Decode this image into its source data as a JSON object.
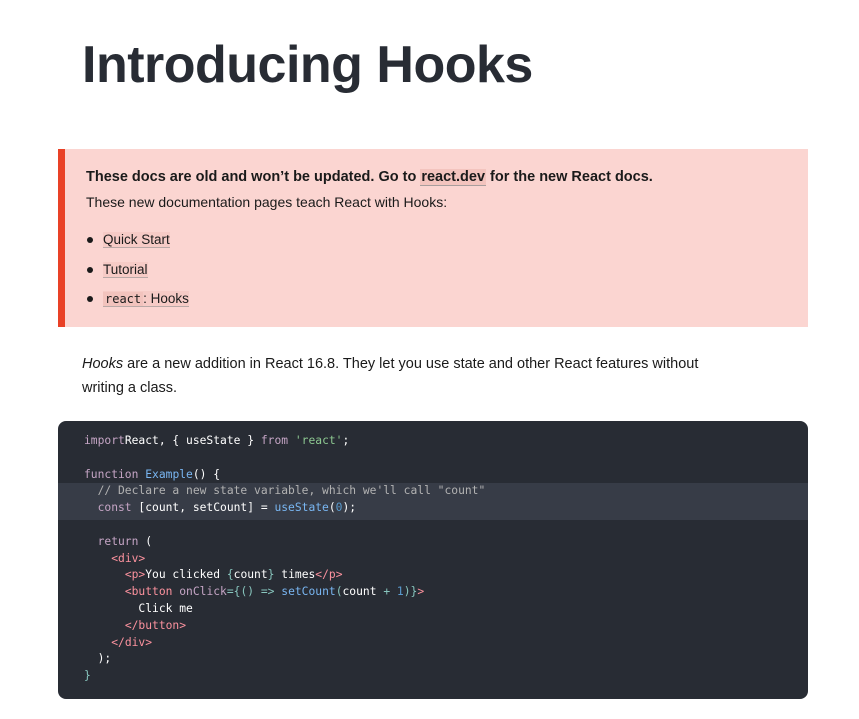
{
  "page": {
    "title": "Introducing Hooks"
  },
  "notice": {
    "heading_before": "These docs are old and won’t be updated. Go to ",
    "heading_link": "react.dev",
    "heading_after": " for the new React docs.",
    "text": "These new documentation pages teach React with Hooks:",
    "items": [
      {
        "label": "Quick Start"
      },
      {
        "label": "Tutorial"
      },
      {
        "code": "react",
        "label": ": Hooks"
      }
    ],
    "colors": {
      "background": "#fbd5d1",
      "border": "#e94126"
    }
  },
  "intro": {
    "em": "Hooks",
    "text": " are a new addition in React 16.8. They let you use state and other React features without writing a class."
  },
  "code": {
    "lines": [
      [
        [
          "k",
          "import"
        ],
        [
          "",
          "React, { useState } "
        ],
        [
          "k",
          "from"
        ],
        [
          "",
          ""
        ],
        [
          "s",
          " 'react'"
        ],
        [
          "",
          ";"
        ]
      ],
      [],
      [
        [
          "k",
          "function"
        ],
        [
          "",
          " "
        ],
        [
          "f",
          "Example"
        ],
        [
          "",
          "() {"
        ]
      ],
      [
        [
          "c",
          "  // Declare a new state variable, which we'll call \"count\""
        ]
      ],
      [
        [
          "k",
          "  const"
        ],
        [
          "",
          " [count, setCount] = "
        ],
        [
          "f",
          "useState"
        ],
        [
          "",
          "("
        ],
        [
          "n",
          "0"
        ],
        [
          "",
          ");"
        ]
      ],
      [],
      [
        [
          "k",
          "  return"
        ],
        [
          "",
          " ("
        ]
      ],
      [
        [
          "",
          "    "
        ],
        [
          "t",
          "<div>"
        ]
      ],
      [
        [
          "",
          "      "
        ],
        [
          "t",
          "<p>"
        ],
        [
          "",
          "You clicked "
        ],
        [
          "p",
          "{"
        ],
        [
          "",
          "count"
        ],
        [
          "p",
          "}"
        ],
        [
          "",
          " times"
        ],
        [
          "t",
          "</p>"
        ]
      ],
      [
        [
          "",
          "      "
        ],
        [
          "t",
          "<button"
        ],
        [
          "",
          " "
        ],
        [
          "a",
          "onClick"
        ],
        [
          "p",
          "={() => "
        ],
        [
          "f",
          "setCount"
        ],
        [
          "p",
          "("
        ],
        [
          "",
          "count"
        ],
        [
          "p",
          " + "
        ],
        [
          "n",
          "1"
        ],
        [
          "p",
          ")}"
        ],
        [
          "t",
          ">"
        ]
      ],
      [
        [
          "",
          "        Click me"
        ]
      ],
      [
        [
          "",
          "      "
        ],
        [
          "t",
          "</button>"
        ]
      ],
      [
        [
          "",
          "    "
        ],
        [
          "t",
          "</div>"
        ]
      ],
      [
        [
          "",
          "  );"
        ]
      ],
      [
        [
          "p",
          "}"
        ]
      ]
    ],
    "colors": {
      "background": "#282c34",
      "highlight": "#373c47"
    }
  }
}
